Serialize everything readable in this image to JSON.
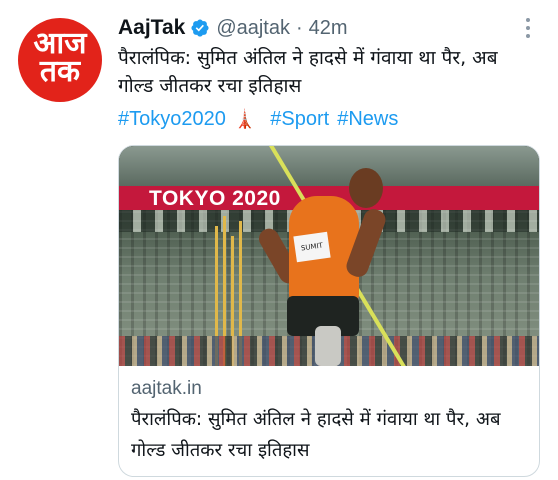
{
  "account": {
    "avatar_line1": "आज",
    "avatar_line2": "तक",
    "display_name": "AajTak",
    "handle": "@aajtak",
    "separator": "·",
    "time": "42m"
  },
  "tweet": {
    "text": "पैरालंपिक: सुमित अंतिल ने हादसे में गंवाया था पैर, अब गोल्ड जीतकर रचा इतिहास",
    "hashtags": [
      "#Tokyo2020",
      "#Sport",
      "#News"
    ],
    "emoji": "🗼"
  },
  "card": {
    "image_banner_text": "TOKYO 2020",
    "bib_text": "SUMIT",
    "domain": "aajtak.in",
    "title": "पैरालंपिक: सुमित अंतिल ने हादसे में गंवाया था पैर, अब गोल्ड जीतकर रचा इतिहास"
  },
  "colors": {
    "brand_red": "#e2231a",
    "link_blue": "#1d9bf0",
    "verified_blue": "#1d9bf0",
    "banner_red": "#c4183c"
  },
  "icons": [
    "verified-badge-icon",
    "more-options-icon",
    "tokyo-tower-emoji"
  ]
}
